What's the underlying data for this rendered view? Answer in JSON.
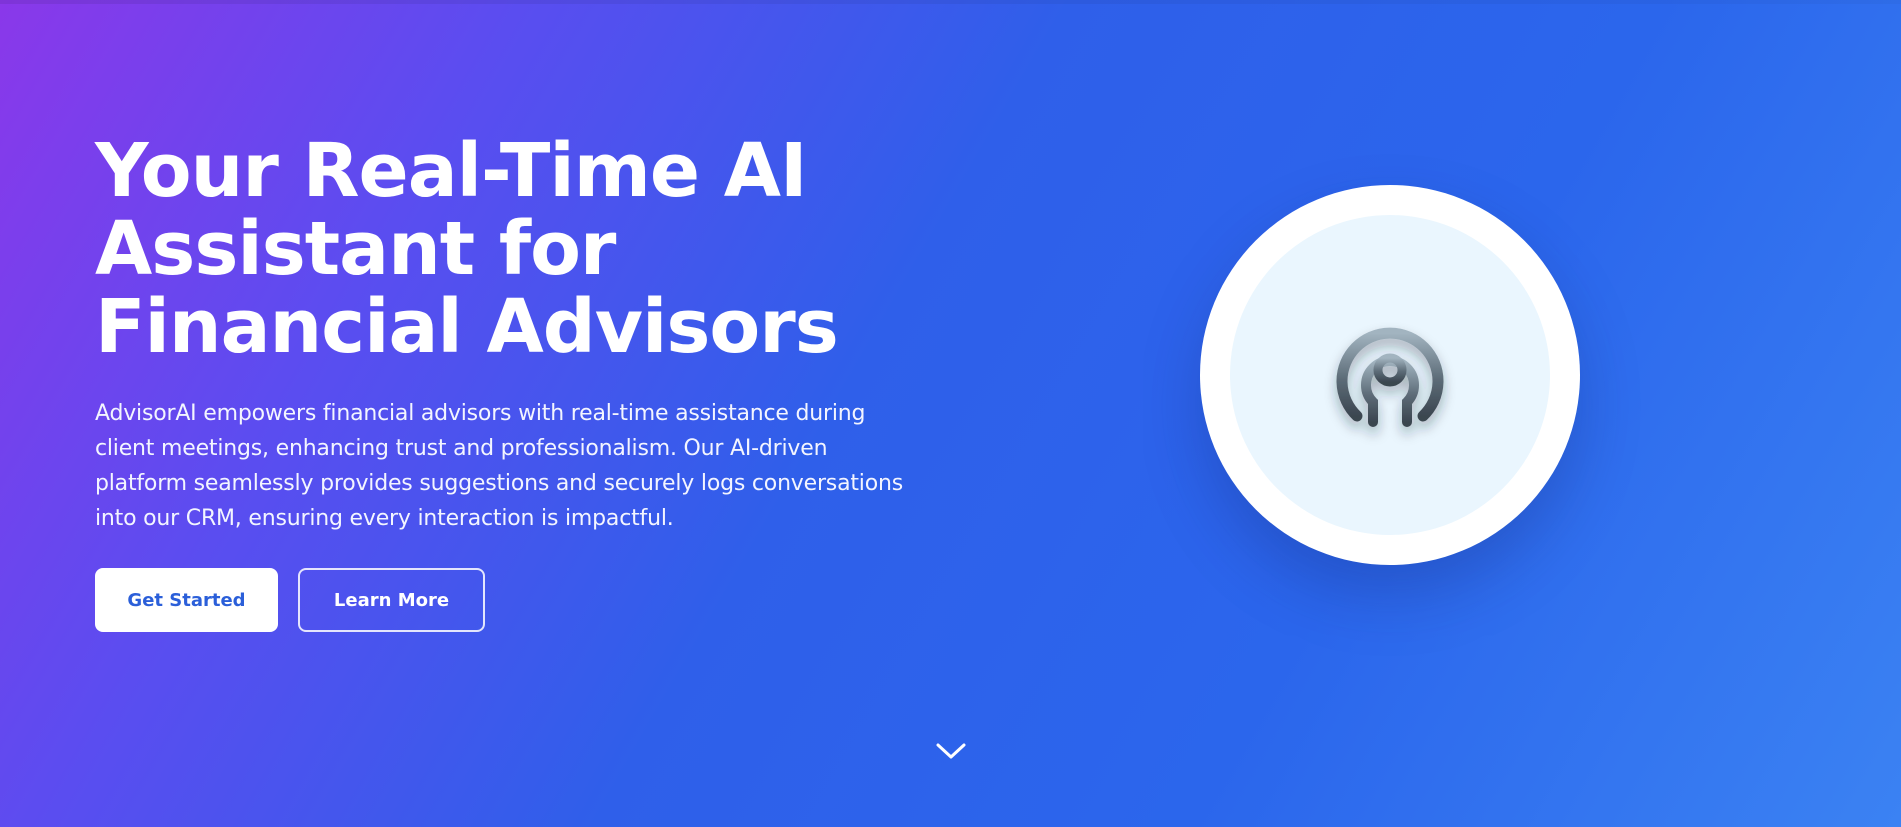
{
  "hero": {
    "headline": "Your Real-Time AI Assistant for Financial Advisors",
    "description": "AdvisorAI empowers financial advisors with real-time assistance during client meetings, enhancing trust and professionalism. Our AI-driven platform seamlessly provides suggestions and securely logs conversations into our CRM, ensuring every interaction is impactful.",
    "primary_button": "Get Started",
    "secondary_button": "Learn More"
  },
  "icons": {
    "logo": "concentric-signal-icon",
    "scroll": "chevron-down-icon"
  },
  "colors": {
    "gradient_start": "#8a38ea",
    "gradient_end": "#3b82f3",
    "primary_button_text": "#2b5fd9",
    "logo_inner_bg": "#eaf6fe",
    "logo_icon": "#4a5866"
  }
}
